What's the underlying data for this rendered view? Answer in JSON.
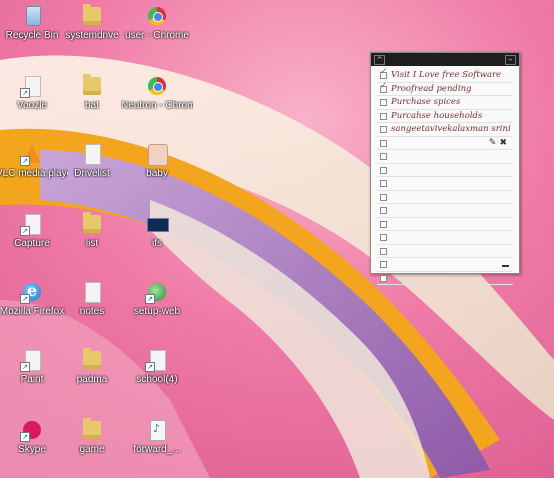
{
  "desktop": {
    "icons": [
      {
        "name": "recycle-bin-icon",
        "label": "Recycle Bin",
        "kind": "recycle"
      },
      {
        "name": "folder-icon",
        "label": "systemdrive",
        "kind": "folder"
      },
      {
        "name": "chrome-icon",
        "label": "user - Chrome",
        "kind": "chrome"
      },
      {
        "name": "voozle-icon",
        "label": "Voozle",
        "kind": "doc"
      },
      {
        "name": "folder-icon",
        "label": "bat",
        "kind": "folder"
      },
      {
        "name": "chrome-icon",
        "label": "Neutron - Chrome",
        "kind": "chrome"
      },
      {
        "name": "vlc-icon",
        "label": "VLC media player",
        "kind": "vlc"
      },
      {
        "name": "document-icon",
        "label": "Drivelist",
        "kind": "doc"
      },
      {
        "name": "baby-image-icon",
        "label": "baby",
        "kind": "baby"
      },
      {
        "name": "capture-icon",
        "label": "Capture",
        "kind": "doc"
      },
      {
        "name": "folder-icon",
        "label": "list",
        "kind": "folder"
      },
      {
        "name": "ifs-icon",
        "label": "ifs",
        "kind": "ifs"
      },
      {
        "name": "firefox-icon",
        "label": "Mozilla Firefox",
        "kind": "ie"
      },
      {
        "name": "document-icon",
        "label": "notes",
        "kind": "doc"
      },
      {
        "name": "network-globe-icon",
        "label": "setup-web",
        "kind": "globe"
      },
      {
        "name": "paint-icon",
        "label": "Paint",
        "kind": "doc"
      },
      {
        "name": "folder-icon",
        "label": "padma",
        "kind": "folder"
      },
      {
        "name": "shortcut-icon",
        "label": "school(4)",
        "kind": "doc"
      },
      {
        "name": "skype-icon",
        "label": "Skype",
        "kind": "skype"
      },
      {
        "name": "folder-icon",
        "label": "game",
        "kind": "folder"
      },
      {
        "name": "mp3-file-icon",
        "label": "forward_...",
        "kind": "mp3"
      }
    ]
  },
  "note": {
    "items": [
      {
        "text": "Visit I Love free Software",
        "checked": true
      },
      {
        "text": "Proofread pending",
        "checked": true
      },
      {
        "text": "Purchase spices",
        "checked": false
      },
      {
        "text": "Purcahse households",
        "checked": false
      },
      {
        "text": "sangeetavivekalaxman srini...",
        "checked": false
      },
      {
        "text": "",
        "checked": false
      },
      {
        "text": "",
        "checked": false
      },
      {
        "text": "",
        "checked": false
      },
      {
        "text": "",
        "checked": false
      },
      {
        "text": "",
        "checked": false
      },
      {
        "text": "",
        "checked": false
      },
      {
        "text": "",
        "checked": false
      },
      {
        "text": "",
        "checked": false
      },
      {
        "text": "",
        "checked": false
      },
      {
        "text": "",
        "checked": false
      },
      {
        "text": "",
        "checked": false
      }
    ],
    "edit_icon": "pencil-icon",
    "delete_icon": "close-icon",
    "text_color": "#7a2f2f"
  },
  "colors": {
    "wallpaper_pink": "#ef7aa6",
    "petal_purple": "#b58ac7",
    "petal_orange": "#f3a51e",
    "petal_cream": "#f4eadd"
  }
}
